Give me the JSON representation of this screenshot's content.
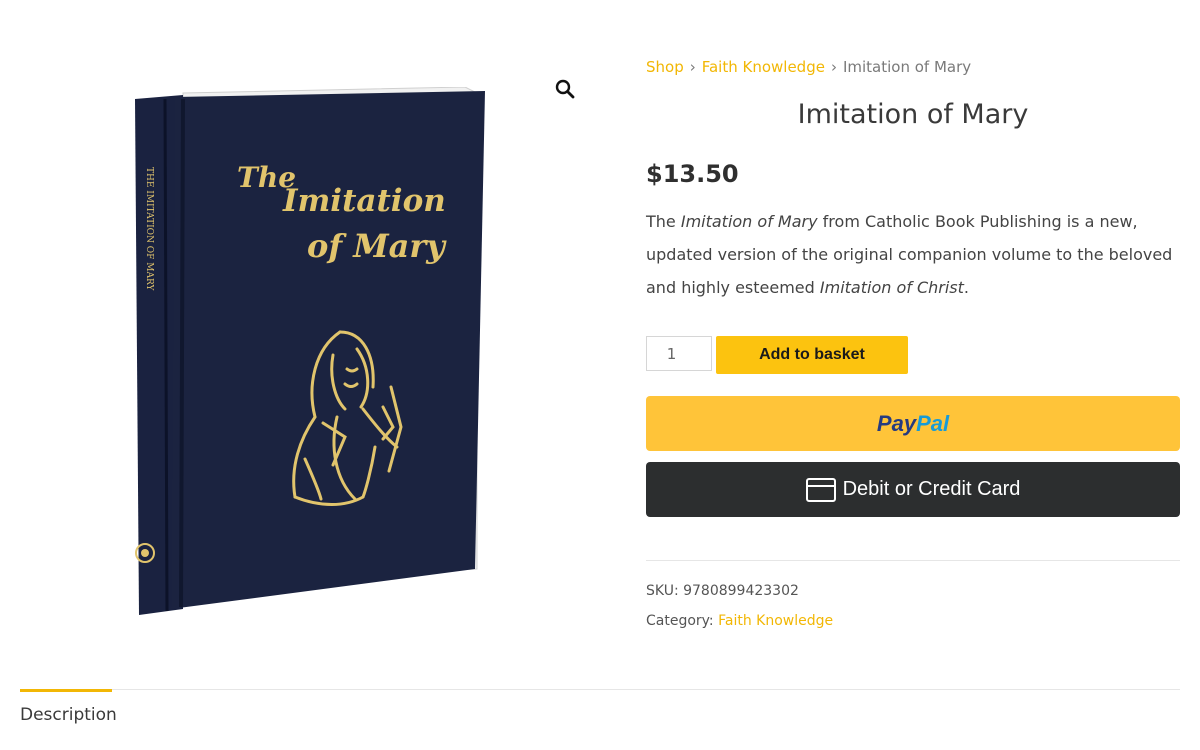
{
  "gallery": {
    "zoom_icon": "magnifier-icon",
    "book_cover": {
      "title_lines": [
        "The",
        "Imitation",
        "of Mary"
      ],
      "spine_text": "THE IMITATION OF MARY",
      "cover_color": "#1b2340",
      "gilt_color": "#e1c46c"
    }
  },
  "breadcrumb": {
    "items": [
      "Shop",
      "Faith Knowledge",
      "Imitation of Mary"
    ],
    "separator": "›"
  },
  "product": {
    "title": "Imitation of Mary",
    "price": "$13.50",
    "description": {
      "part1": "The ",
      "em1": "Imitation of Mary",
      "part2": " from Catholic Book Publishing is a new, updated version of the original companion volume to the beloved and highly esteemed ",
      "em2": "Imitation of Christ",
      "part3": "."
    },
    "quantity": "1",
    "add_label": "Add to basket"
  },
  "payment": {
    "paypal": {
      "pay": "Pay",
      "pal": "Pal"
    },
    "card_label": "Debit or Credit Card"
  },
  "meta": {
    "sku_label": "SKU:",
    "sku_value": "9780899423302",
    "category_label": "Category:",
    "category_value": "Faith Knowledge"
  },
  "tabs": {
    "items": [
      "Description"
    ],
    "active": "Description"
  },
  "colors": {
    "accent": "#f2b705",
    "add_button": "#fcc30f",
    "paypal_button": "#ffc439",
    "card_button": "#2c2e2f"
  }
}
